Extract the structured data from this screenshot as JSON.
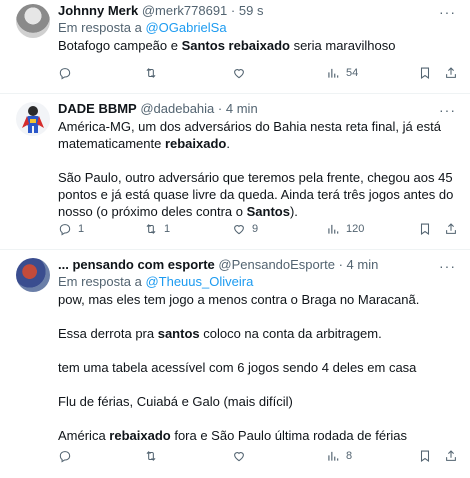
{
  "tweets": [
    {
      "name": "Johnny Merk",
      "handle": "@merk778691",
      "sep": "·",
      "time": "59 s",
      "reply_prefix": "Em resposta a",
      "reply_to": "@OGabrielSa",
      "p1": [
        "Botafogo campeão e ",
        "Santos rebaixado",
        " seria maravilhoso"
      ],
      "actions": {
        "reply": "",
        "retweet": "",
        "like": "",
        "views": "54"
      }
    },
    {
      "name": "DADE BBMP",
      "handle": "@dadebahia",
      "sep": "·",
      "time": "4 min",
      "p1": [
        "América-MG, um dos adversários do Bahia nesta reta final, já está matematicamente ",
        "rebaixado",
        "."
      ],
      "p2": [
        "São Paulo, outro adversário que teremos pela frente, chegou aos 45 pontos e já está quase livre da queda. Ainda terá três jogos antes do nosso (o próximo deles contra o ",
        "Santos",
        ")."
      ],
      "actions": {
        "reply": "1",
        "retweet": "1",
        "like": "9",
        "views": "120"
      }
    },
    {
      "name": "... pensando com esporte",
      "handle": "@PensandoEsporte",
      "sep": "·",
      "time": "4 min",
      "reply_prefix": "Em resposta a",
      "reply_to": "@Theuus_Oliveira",
      "p1": "pow, mas eles tem jogo a menos contra o Braga no Maracanã.",
      "p2": [
        "Essa derrota pra ",
        "santos",
        " coloco na conta da arbitragem."
      ],
      "p3": "tem uma tabela acessível com 6 jogos sendo 4 deles em casa",
      "p4": "Flu de férias, Cuiabá e Galo (mais difícil)",
      "p5": [
        "América ",
        "rebaixado",
        " fora e São Paulo última rodada de férias"
      ],
      "actions": {
        "reply": "",
        "retweet": "",
        "like": "",
        "views": "8"
      }
    }
  ],
  "icons": {
    "more": "more-horizontal-icon",
    "reply": "reply-bubble-icon",
    "retweet": "retweet-icon",
    "like": "heart-icon",
    "views": "views-chart-icon",
    "bookmark": "bookmark-icon",
    "share": "share-icon"
  },
  "colors": {
    "link": "#1d9bf0",
    "muted": "#536471",
    "text": "#0f1419",
    "divider": "#eff3f4"
  }
}
